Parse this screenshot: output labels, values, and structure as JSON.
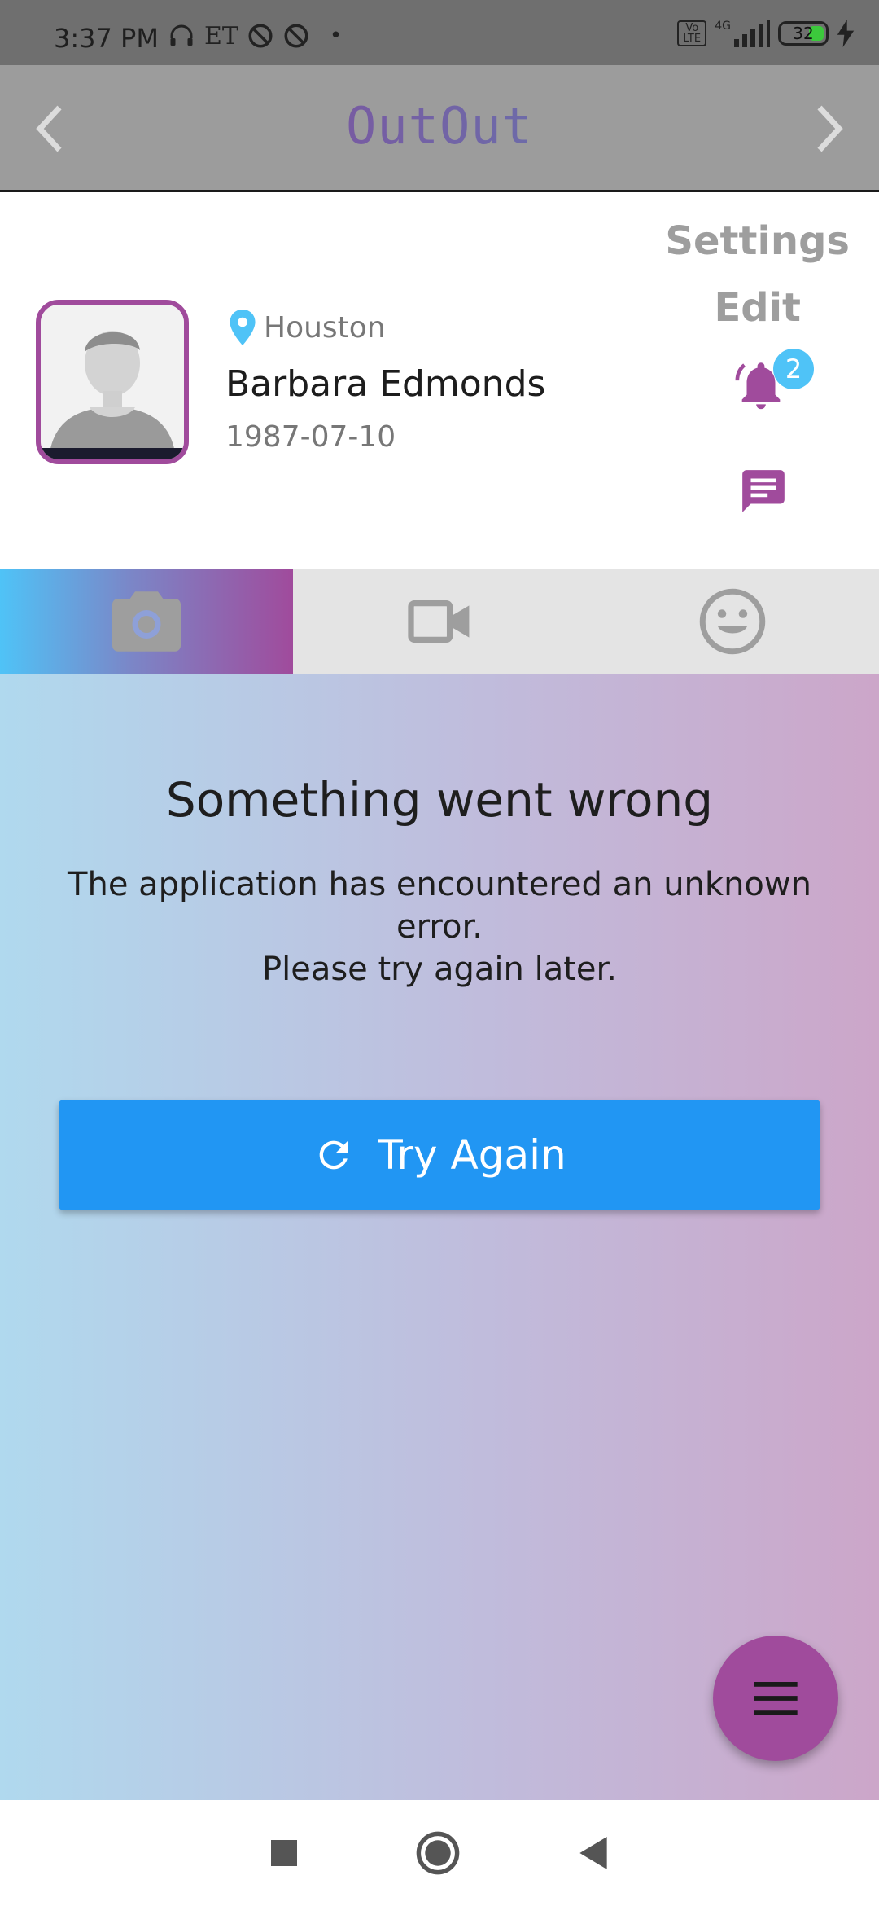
{
  "status_bar": {
    "time": "3:37 PM",
    "carrier_label": "ET",
    "network_label": "4G",
    "volte_label": "Vo LTE",
    "battery_level": "32"
  },
  "app_bar": {
    "logo_text": "OutOut",
    "back_icon": "chevron-left-icon",
    "forward_icon": "chevron-right-icon"
  },
  "profile": {
    "location": "Houston",
    "name": "Barbara Edmonds",
    "dob": "1987-07-10",
    "settings_label": "Settings",
    "edit_label": "Edit",
    "notification_count": "2"
  },
  "tabs": [
    {
      "icon": "camera-icon",
      "active": true
    },
    {
      "icon": "video-camera-icon",
      "active": false
    },
    {
      "icon": "smiley-icon",
      "active": false
    }
  ],
  "error": {
    "title": "Something went wrong",
    "message_line1": "The application has encountered an unknown error.",
    "message_line2": "Please try again later.",
    "button_label": "Try Again"
  },
  "colors": {
    "brand_purple": "#a04b9c",
    "accent_blue": "#2196f3",
    "badge_blue": "#4fc3f7"
  }
}
